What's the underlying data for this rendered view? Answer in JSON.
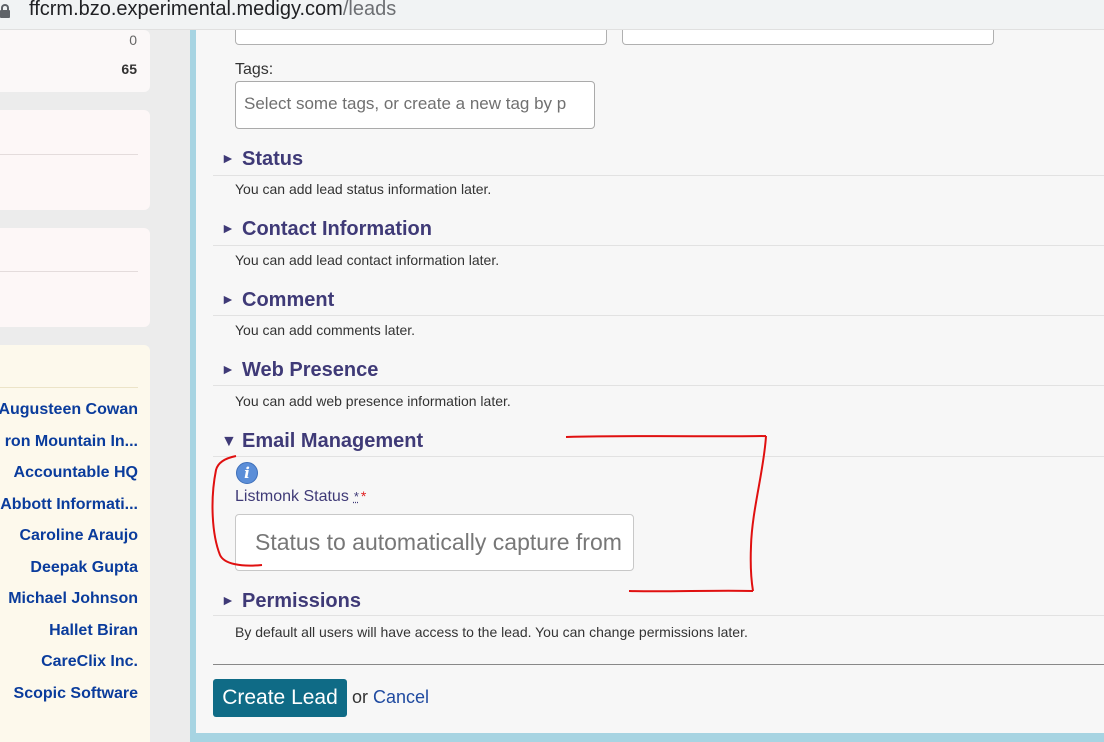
{
  "browser": {
    "url_host": "ffcrm.bzo.experimental.medigy.com",
    "url_path": "/leads"
  },
  "sidebar": {
    "counts": [
      "0",
      "65"
    ],
    "recent_items": [
      "Augusteen Cowan",
      "ron Mountain In...",
      "Accountable HQ",
      "Abbott Informati...",
      "Caroline Araujo",
      "Deepak Gupta",
      "Michael Johnson",
      "Hallet Biran",
      "CareClix Inc.",
      "Scopic Software"
    ]
  },
  "form": {
    "tags": {
      "label": "Tags:",
      "placeholder": "Select some tags, or create a new tag by p"
    },
    "sections": [
      {
        "title": "Status",
        "note": "You can add lead status information later."
      },
      {
        "title": "Contact Information",
        "note": "You can add lead contact information later."
      },
      {
        "title": "Comment",
        "note": "You can add comments later."
      },
      {
        "title": "Web Presence",
        "note": "You can add web presence information later."
      },
      {
        "title": "Email Management",
        "note": ""
      },
      {
        "title": "Permissions",
        "note": "By default all users will have access to the lead. You can change permissions later."
      }
    ],
    "email_management": {
      "field_label": "Listmonk Status",
      "tooltip_marker": "*",
      "required_marker": "*",
      "placeholder": "Status to automatically capture from"
    },
    "actions": {
      "submit": "Create Lead",
      "or": "or",
      "cancel": "Cancel"
    },
    "colors": {
      "section_title": "#3f3a77",
      "button": "#0f6b86",
      "annotation": "#e01010"
    }
  }
}
